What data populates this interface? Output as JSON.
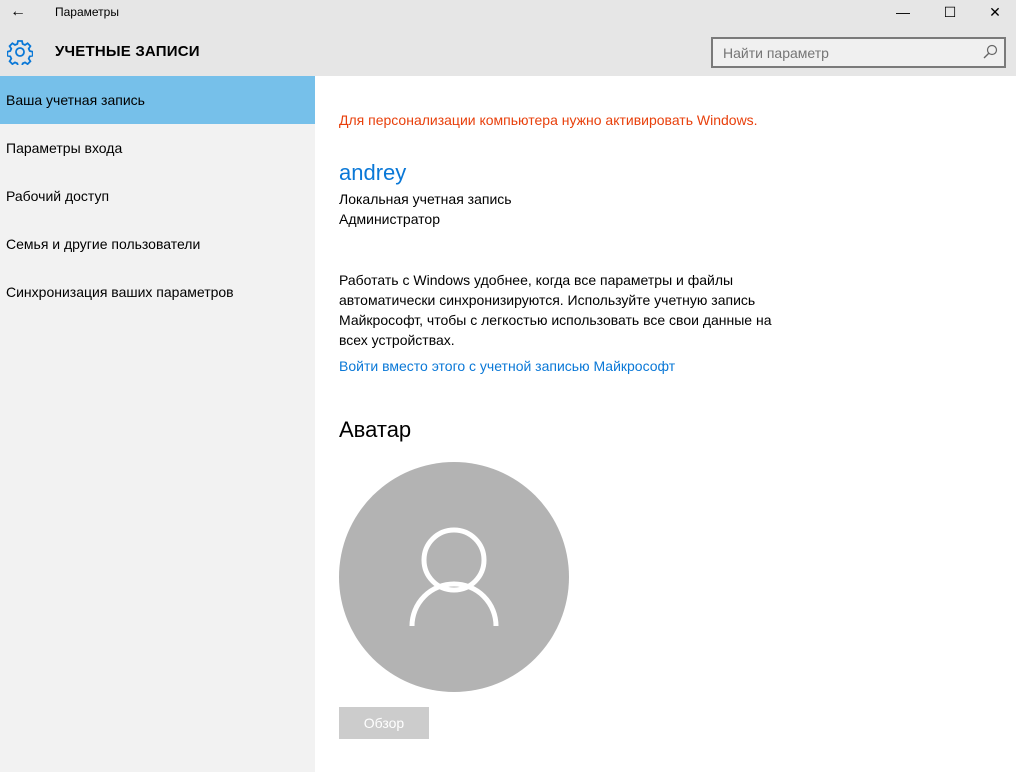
{
  "window": {
    "title": "Параметры",
    "back_icon": "arrow-left-icon",
    "minimize": "—",
    "maximize": "☐",
    "close": "✕"
  },
  "header": {
    "section": "УЧЕТНЫЕ ЗАПИСИ",
    "search_placeholder": "Найти параметр",
    "accent": "#0a78d7"
  },
  "sidebar": {
    "items": [
      {
        "label": "Ваша учетная запись"
      },
      {
        "label": "Параметры входа"
      },
      {
        "label": "Рабочий доступ"
      },
      {
        "label": "Семья и другие пользователи"
      },
      {
        "label": "Синхронизация ваших параметров"
      }
    ]
  },
  "main": {
    "activation_warning": "Для персонализации компьютера нужно активировать Windows.",
    "username": "andrey",
    "account_type": "Локальная учетная запись",
    "role": "Администратор",
    "sync_text": "Работать с Windows удобнее, когда все параметры и файлы автоматически синхронизируются. Используйте учетную запись Майкрософт, чтобы с легкостью использовать все свои данные на всех устройствах.",
    "ms_link": "Войти вместо этого с учетной записью Майкрософт",
    "avatar_title": "Аватар",
    "browse_button": "Обзор"
  }
}
